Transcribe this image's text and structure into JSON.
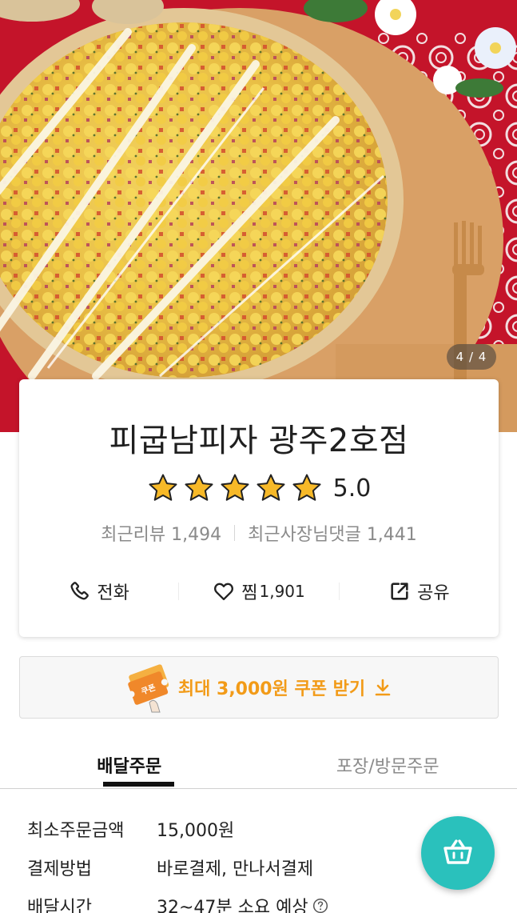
{
  "hero": {
    "image": "pizza-photo",
    "page_indicator": "4 / 4"
  },
  "store": {
    "name": "피굽남피자 광주2호점",
    "rating": 5.0,
    "rating_text": "5.0",
    "star_count": 5,
    "star_color": "#f7b928",
    "recent_reviews_label": "최근리뷰 1,494",
    "recent_owner_comments_label": "최근사장님댓글 1,441"
  },
  "actions": {
    "call": {
      "label": "전화",
      "icon": "phone-icon"
    },
    "favorite": {
      "label": "찜",
      "count": "1,901",
      "icon": "heart-icon"
    },
    "share": {
      "label": "공유",
      "icon": "share-icon"
    }
  },
  "coupon": {
    "text": "최대 3,000원 쿠폰 받기",
    "icon": "coupon-ticket-icon",
    "download_icon": "download-icon",
    "accent_color": "#f29b18"
  },
  "tabs": [
    {
      "label": "배달주문",
      "active": true
    },
    {
      "label": "포장/방문주문",
      "active": false
    }
  ],
  "info": {
    "min_order": {
      "label": "최소주문금액",
      "value": "15,000원"
    },
    "payment": {
      "label": "결제방법",
      "value": "바로결제, 만나서결제"
    },
    "delivery_time": {
      "label": "배달시간",
      "value": "32~47분 소요 예상"
    }
  },
  "cart": {
    "icon": "cart-basket-icon",
    "color": "#2ac1bc"
  }
}
